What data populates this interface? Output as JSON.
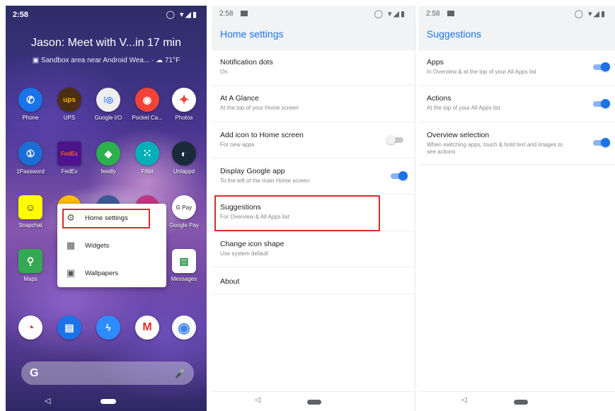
{
  "home": {
    "time": "2:58",
    "status_icons": "◯ ▾◢▮",
    "glance_title": "Jason: Meet with V...in 17 min",
    "glance_sub": "Sandbox area near Android Wea... · ☁ 71°F",
    "apps_row1": [
      {
        "label": "Phone",
        "glyph": "✆",
        "color": "#1a73e8"
      },
      {
        "label": "UPS",
        "glyph": "ups",
        "color": "#4b2e14"
      },
      {
        "label": "Google I/O",
        "glyph": "⁝◎",
        "color": "#eeeeee"
      },
      {
        "label": "Pocket Ca...",
        "glyph": "◉",
        "color": "#f44336"
      },
      {
        "label": "Photos",
        "glyph": "✦",
        "color": "#ffffff"
      }
    ],
    "apps_row2": [
      {
        "label": "1Password",
        "glyph": "①",
        "color": "#1a6fd6"
      },
      {
        "label": "FedEx",
        "glyph": "FedEx",
        "color": "#4d148c"
      },
      {
        "label": "feedly",
        "glyph": "◆",
        "color": "#2bb24c"
      },
      {
        "label": "Fitbit",
        "glyph": "⁙",
        "color": "#00b0b9"
      },
      {
        "label": "Untappd",
        "glyph": "◐",
        "color": "#1b2a3a"
      }
    ],
    "apps_row3": [
      {
        "label": "Snapchat",
        "glyph": "☺",
        "color": "#fffc00"
      },
      {
        "label": "",
        "glyph": "",
        "color": "#fbbc04"
      },
      {
        "label": "",
        "glyph": "",
        "color": "#3b5998"
      },
      {
        "label": "",
        "glyph": "",
        "color": "#c13584"
      },
      {
        "label": "Google Pay",
        "glyph": "G Pay",
        "color": "#ffffff"
      }
    ],
    "apps_row4": [
      {
        "label": "Maps",
        "glyph": "⚲",
        "color": "#34a853"
      },
      {
        "label": "Messages",
        "glyph": "▤",
        "color": "#ffffff"
      }
    ],
    "dock": [
      {
        "label": "",
        "glyph": "◔",
        "color": "#ffffff"
      },
      {
        "label": "",
        "glyph": "▤",
        "color": "#1a73e8"
      },
      {
        "label": "",
        "glyph": "ϟ",
        "color": "#2e8cff"
      },
      {
        "label": "",
        "glyph": "M",
        "color": "#ffffff"
      },
      {
        "label": "",
        "glyph": "◉",
        "color": "#ffffff"
      }
    ],
    "menu": {
      "home_settings": "Home settings",
      "widgets": "Widgets",
      "wallpapers": "Wallpapers"
    },
    "search_g": "G",
    "mic": "🎤"
  },
  "settings": {
    "time": "2:58",
    "status_icons": "◯ ▾◢▮",
    "title": "Home settings",
    "rows": [
      {
        "title": "Notification dots",
        "sub": "On"
      },
      {
        "title": "At A Glance",
        "sub": "At the top of your Home screen"
      },
      {
        "title": "Add icon to Home screen",
        "sub": "For new apps"
      },
      {
        "title": "Display Google app",
        "sub": "To the left of the main Home screen"
      },
      {
        "title": "Suggestions",
        "sub": "For Overview & All Apps list"
      },
      {
        "title": "Change icon shape",
        "sub": "Use system default"
      },
      {
        "title": "About",
        "sub": ""
      }
    ],
    "nav_back": "◁"
  },
  "suggestions": {
    "time": "2:58",
    "status_icons": "◯ ▾◢▮",
    "title": "Suggestions",
    "rows": [
      {
        "title": "Apps",
        "sub": "In Overview & at the top of your All Apps list"
      },
      {
        "title": "Actions",
        "sub": "At the top of your All Apps list"
      },
      {
        "title": "Overview selection",
        "sub": "When switching apps, touch & hold text and images to see actions"
      }
    ],
    "nav_back": "◁"
  }
}
